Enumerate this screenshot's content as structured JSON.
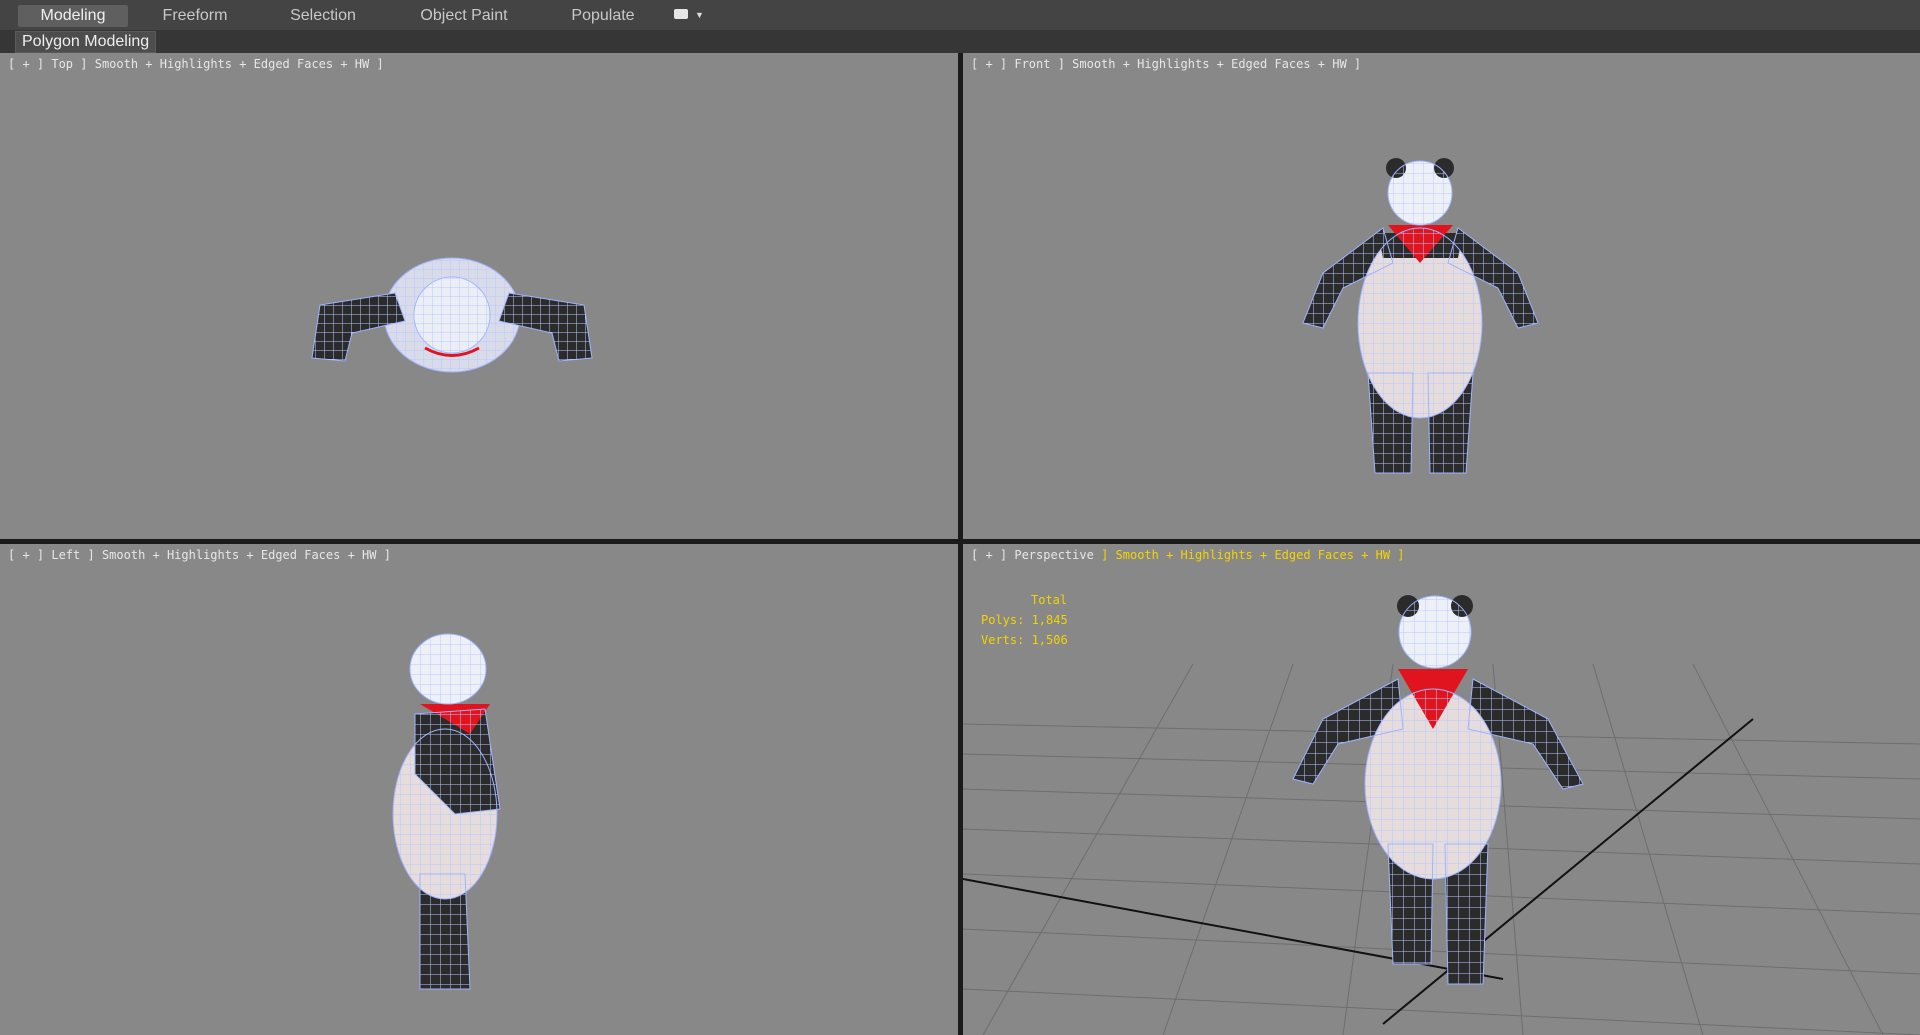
{
  "ribbon": {
    "tabs": [
      {
        "label": "Modeling",
        "active": true
      },
      {
        "label": "Freeform",
        "active": false
      },
      {
        "label": "Selection",
        "active": false
      },
      {
        "label": "Object Paint",
        "active": false
      },
      {
        "label": "Populate",
        "active": false
      }
    ],
    "options_icon": "dropdown-options-icon"
  },
  "subbar": {
    "panel_label": "Polygon Modeling"
  },
  "viewports": {
    "top": {
      "prefix": "[ + ] ",
      "view": "Top",
      "mode": " ] Smooth + Highlights + Edged Faces + HW ]"
    },
    "front": {
      "prefix": "[ + ] ",
      "view": "Front",
      "mode": " ] Smooth + Highlights + Edged Faces + HW ]"
    },
    "left": {
      "prefix": "[ + ] ",
      "view": "Left",
      "mode": " ] Smooth + Highlights + Edged Faces + HW ]"
    },
    "persp": {
      "prefix": "[ + ] ",
      "view": "Perspective",
      "mode_hl": " ] Smooth + Highlights + Edged Faces + HW ]"
    }
  },
  "stats": {
    "total": "Total",
    "polys": "Polys: 1,845",
    "verts": "Verts: 1,506"
  },
  "colors": {
    "viewport_bg": "#888888",
    "wire": "#b8c8ff",
    "accent_yellow": "#f3d400",
    "scarf": "#e0141e"
  }
}
